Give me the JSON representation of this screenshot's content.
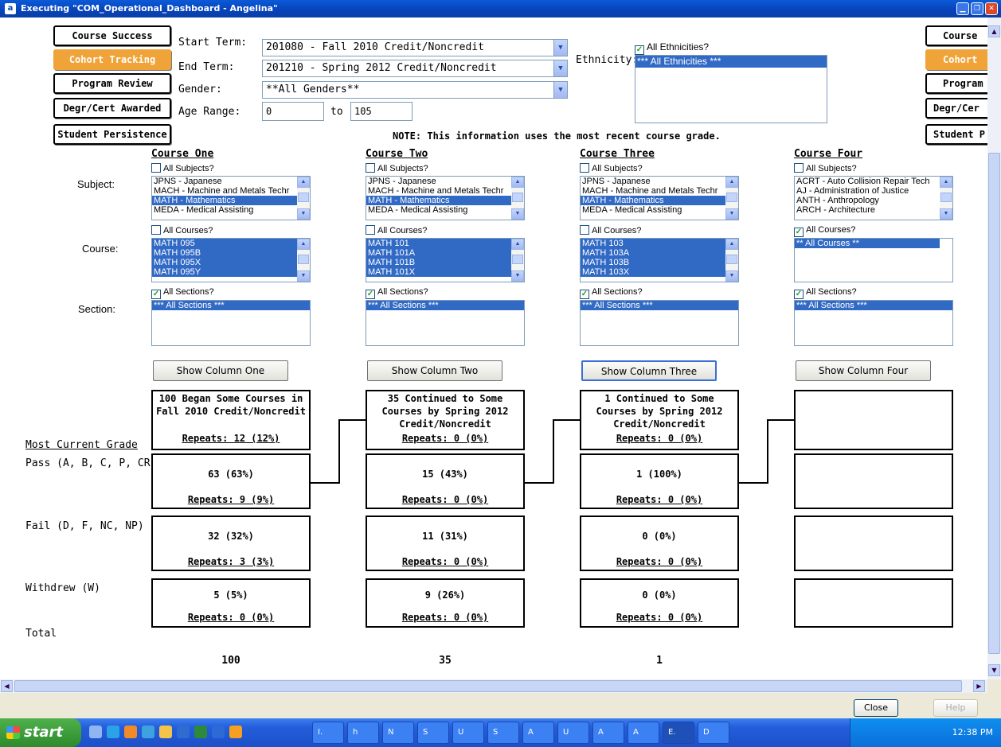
{
  "window": {
    "title": "Executing \"COM_Operational_Dashboard - Angelina\""
  },
  "nav": {
    "left": [
      "Course Success",
      "Cohort Tracking",
      "Program Review",
      "Degr/Cert Awarded",
      "Student Persistence"
    ],
    "right": [
      "Course",
      "Cohort",
      "Program",
      "Degr/Cer",
      "Student P"
    ],
    "active_index": 1
  },
  "filters": {
    "start_term_label": "Start Term:",
    "start_term": "201080 - Fall 2010 Credit/Noncredit",
    "end_term_label": "End Term:",
    "end_term": "201210 - Spring 2012 Credit/Noncredit",
    "gender_label": "Gender:",
    "gender": "**All Genders**",
    "age_label": "Age Range:",
    "age_from": "0",
    "age_to_label": "to",
    "age_to": "105",
    "ethnicity_label": "Ethnicity:",
    "all_ethnicities_label": "All Ethnicities?",
    "ethnicity_selected": "*** All Ethnicities ***"
  },
  "note": "NOTE: This information uses the most recent course grade.",
  "labels": {
    "subject": "Subject:",
    "course": "Course:",
    "section": "Section:",
    "all_subjects": "All Subjects?",
    "all_courses": "All Courses?",
    "all_sections": "All Sections?",
    "most_current_grade": "Most Current Grade",
    "pass": "Pass (A, B, C, P, CR)",
    "fail": "Fail (D, F, NC, NP)",
    "withdrew": "Withdrew (W)",
    "total": "Total"
  },
  "columns": [
    {
      "heading": "Course One",
      "subjects": [
        "JPNS - Japanese",
        "MACH - Machine and Metals Techr",
        "MATH - Mathematics",
        "MEDA - Medical Assisting"
      ],
      "courses": [
        "MATH 095",
        "MATH 095B",
        "MATH 095X",
        "MATH 095Y"
      ],
      "section": "*** All Sections ***",
      "button": "Show Column One",
      "summary": [
        "100 Began Some Courses in",
        "Fall 2010 Credit/Noncredit"
      ],
      "summary_repeats": "Repeats: 12 (12%)",
      "pass": "63 (63%)",
      "pass_repeats": "Repeats: 9 (9%)",
      "fail": "32 (32%)",
      "fail_repeats": "Repeats: 3 (3%)",
      "withdrew": "5 (5%)",
      "withdrew_repeats": "Repeats: 0 (0%)",
      "total": "100"
    },
    {
      "heading": "Course Two",
      "subjects": [
        "JPNS - Japanese",
        "MACH - Machine and Metals Techr",
        "MATH - Mathematics",
        "MEDA - Medical Assisting"
      ],
      "courses": [
        "MATH 101",
        "MATH 101A",
        "MATH 101B",
        "MATH 101X"
      ],
      "section": "*** All Sections ***",
      "button": "Show Column Two",
      "summary": [
        "35 Continued to Some",
        "Courses by Spring 2012",
        "Credit/Noncredit"
      ],
      "summary_repeats": "Repeats: 0 (0%)",
      "pass": "15 (43%)",
      "pass_repeats": "Repeats: 0 (0%)",
      "fail": "11 (31%)",
      "fail_repeats": "Repeats: 0 (0%)",
      "withdrew": "9 (26%)",
      "withdrew_repeats": "Repeats: 0 (0%)",
      "total": "35"
    },
    {
      "heading": "Course Three",
      "subjects": [
        "JPNS - Japanese",
        "MACH - Machine and Metals Techr",
        "MATH - Mathematics",
        "MEDA - Medical Assisting"
      ],
      "courses": [
        "MATH 103",
        "MATH 103A",
        "MATH 103B",
        "MATH 103X"
      ],
      "section": "*** All Sections ***",
      "button": "Show Column Three",
      "summary": [
        "1 Continued to Some",
        "Courses by Spring 2012",
        "Credit/Noncredit"
      ],
      "summary_repeats": "Repeats: 0 (0%)",
      "pass": "1 (100%)",
      "pass_repeats": "Repeats: 0 (0%)",
      "fail": "0 (0%)",
      "fail_repeats": "Repeats: 0 (0%)",
      "withdrew": "0 (0%)",
      "withdrew_repeats": "Repeats: 0 (0%)",
      "total": "1"
    },
    {
      "heading": "Course Four",
      "subjects": [
        "ACRT - Auto Collision Repair Tech",
        "AJ - Administration of Justice",
        "ANTH - Anthropology",
        "ARCH - Architecture"
      ],
      "courses": [
        "** All Courses **"
      ],
      "section": "*** All Sections ***",
      "button": "Show Column Four",
      "summary": [],
      "summary_repeats": "",
      "pass": "",
      "pass_repeats": "",
      "fail": "",
      "fail_repeats": "",
      "withdrew": "",
      "withdrew_repeats": "",
      "total": ""
    }
  ],
  "footer": {
    "close": "Close",
    "help": "Help"
  },
  "taskbar": {
    "start": "start",
    "tasks": [
      "I.",
      "h",
      "N",
      "S",
      "U",
      "S",
      "A",
      "U",
      "A",
      "A",
      "E.",
      "D"
    ],
    "clock": "12:38 PM"
  }
}
